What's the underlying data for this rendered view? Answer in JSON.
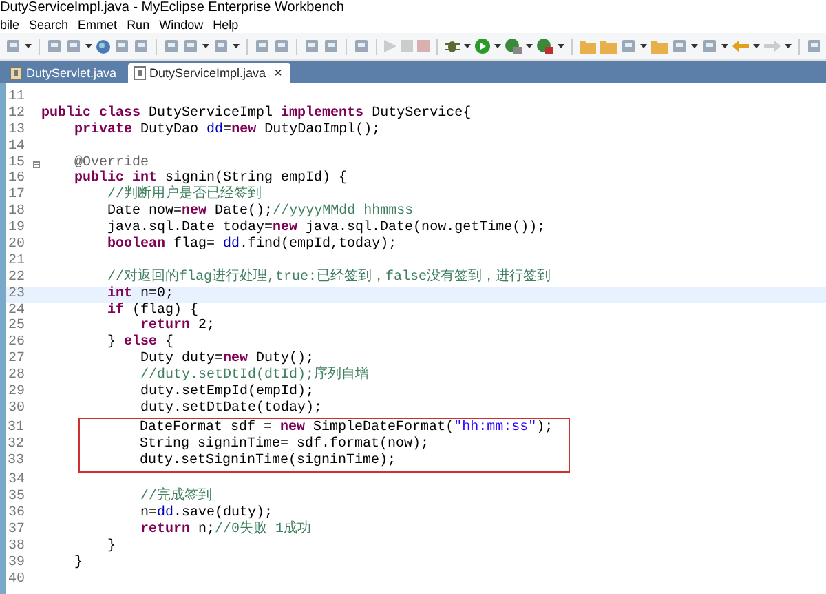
{
  "window": {
    "title": "DutyServiceImpl.java - MyEclipse Enterprise Workbench"
  },
  "menu": [
    "bile",
    "Search",
    "Emmet",
    "Run",
    "Window",
    "Help"
  ],
  "tabs": [
    {
      "label": "DutyServlet.java",
      "selected": false,
      "closable": false
    },
    {
      "label": "DutyServiceImpl.java",
      "selected": true,
      "closable": true
    }
  ],
  "close_glyph": "×",
  "editor": {
    "lines": [
      {
        "number": "11",
        "fold": false,
        "current": false,
        "in_box": false
      },
      {
        "number": "12",
        "fold": false,
        "current": false,
        "in_box": false,
        "segments": [
          {
            "kind": "keyword",
            "text": "public class"
          },
          {
            "kind": "plain",
            "text": " DutyServiceImpl "
          },
          {
            "kind": "keyword",
            "text": "implements"
          },
          {
            "kind": "plain",
            "text": " DutyService{"
          }
        ]
      },
      {
        "number": "13",
        "fold": false,
        "current": false,
        "in_box": false,
        "segments": [
          {
            "kind": "keyword",
            "text": "    private"
          },
          {
            "kind": "plain",
            "text": " DutyDao "
          },
          {
            "kind": "field",
            "text": "dd"
          },
          {
            "kind": "plain",
            "text": "="
          },
          {
            "kind": "keyword",
            "text": "new"
          },
          {
            "kind": "plain",
            "text": " DutyDaoImpl();"
          }
        ]
      },
      {
        "number": "14",
        "fold": false,
        "current": false,
        "in_box": false
      },
      {
        "number": "15",
        "fold": true,
        "current": false,
        "in_box": false,
        "segments": [
          {
            "kind": "annotation",
            "text": "    @Override"
          }
        ]
      },
      {
        "number": "16",
        "fold": false,
        "current": false,
        "in_box": false,
        "segments": [
          {
            "kind": "keyword",
            "text": "    public int"
          },
          {
            "kind": "plain",
            "text": " signin(String empId) {"
          }
        ]
      },
      {
        "number": "17",
        "fold": false,
        "current": false,
        "in_box": false,
        "segments": [
          {
            "kind": "comment",
            "text": "        //判断用户是否已经签到"
          }
        ]
      },
      {
        "number": "18",
        "fold": false,
        "current": false,
        "in_box": false,
        "segments": [
          {
            "kind": "plain",
            "text": "        Date now="
          },
          {
            "kind": "keyword",
            "text": "new"
          },
          {
            "kind": "plain",
            "text": " Date();"
          },
          {
            "kind": "comment",
            "text": "//yyyyMMdd hhmmss"
          }
        ]
      },
      {
        "number": "19",
        "fold": false,
        "current": false,
        "in_box": false,
        "segments": [
          {
            "kind": "plain",
            "text": "        java.sql.Date today="
          },
          {
            "kind": "keyword",
            "text": "new"
          },
          {
            "kind": "plain",
            "text": " java.sql.Date(now.getTime());"
          }
        ]
      },
      {
        "number": "20",
        "fold": false,
        "current": false,
        "in_box": false,
        "segments": [
          {
            "kind": "keyword",
            "text": "        boolean"
          },
          {
            "kind": "plain",
            "text": " flag= "
          },
          {
            "kind": "field",
            "text": "dd"
          },
          {
            "kind": "plain",
            "text": ".find(empId,today);"
          }
        ]
      },
      {
        "number": "21",
        "fold": false,
        "current": false,
        "in_box": false
      },
      {
        "number": "22",
        "fold": false,
        "current": false,
        "in_box": false,
        "segments": [
          {
            "kind": "comment",
            "text": "        //对返回的flag进行处理,true:已经签到，false没有签到，进行签到"
          }
        ]
      },
      {
        "number": "23",
        "fold": false,
        "current": true,
        "in_box": false,
        "segments": [
          {
            "kind": "keyword",
            "text": "        int"
          },
          {
            "kind": "plain",
            "text": " n=0;"
          }
        ]
      },
      {
        "number": "24",
        "fold": false,
        "current": false,
        "in_box": false,
        "segments": [
          {
            "kind": "keyword",
            "text": "        if"
          },
          {
            "kind": "plain",
            "text": " (flag) {"
          }
        ]
      },
      {
        "number": "25",
        "fold": false,
        "current": false,
        "in_box": false,
        "segments": [
          {
            "kind": "keyword",
            "text": "            return"
          },
          {
            "kind": "plain",
            "text": " 2;"
          }
        ]
      },
      {
        "number": "26",
        "fold": false,
        "current": false,
        "in_box": false,
        "segments": [
          {
            "kind": "plain",
            "text": "        } "
          },
          {
            "kind": "keyword",
            "text": "else"
          },
          {
            "kind": "plain",
            "text": " {"
          }
        ]
      },
      {
        "number": "27",
        "fold": false,
        "current": false,
        "in_box": false,
        "segments": [
          {
            "kind": "plain",
            "text": "            Duty duty="
          },
          {
            "kind": "keyword",
            "text": "new"
          },
          {
            "kind": "plain",
            "text": " Duty();"
          }
        ]
      },
      {
        "number": "28",
        "fold": false,
        "current": false,
        "in_box": false,
        "segments": [
          {
            "kind": "comment",
            "text": "            //duty.setDtId(dtId);序列自增"
          }
        ]
      },
      {
        "number": "29",
        "fold": false,
        "current": false,
        "in_box": false,
        "segments": [
          {
            "kind": "plain",
            "text": "            duty.setEmpId(empId);"
          }
        ]
      },
      {
        "number": "30",
        "fold": false,
        "current": false,
        "in_box": false,
        "segments": [
          {
            "kind": "plain",
            "text": "            duty.setDtDate(today);"
          }
        ]
      },
      {
        "number": "31",
        "fold": false,
        "current": false,
        "in_box": true,
        "segments": [
          {
            "kind": "plain",
            "text": "            DateFormat sdf = "
          },
          {
            "kind": "keyword",
            "text": "new"
          },
          {
            "kind": "plain",
            "text": " SimpleDateFormat("
          },
          {
            "kind": "string",
            "text": "\"hh:mm:ss\""
          },
          {
            "kind": "plain",
            "text": ");"
          }
        ]
      },
      {
        "number": "32",
        "fold": false,
        "current": false,
        "in_box": true,
        "segments": [
          {
            "kind": "plain",
            "text": "            String signinTime= sdf.format(now);"
          }
        ]
      },
      {
        "number": "33",
        "fold": false,
        "current": false,
        "in_box": true,
        "segments": [
          {
            "kind": "plain",
            "text": "            duty.setSigninTime(signinTime);"
          }
        ]
      },
      {
        "number": "34",
        "fold": false,
        "current": false,
        "in_box": false
      },
      {
        "number": "35",
        "fold": false,
        "current": false,
        "in_box": false,
        "segments": [
          {
            "kind": "comment",
            "text": "            //完成签到"
          }
        ]
      },
      {
        "number": "36",
        "fold": false,
        "current": false,
        "in_box": false,
        "segments": [
          {
            "kind": "plain",
            "text": "            n="
          },
          {
            "kind": "field",
            "text": "dd"
          },
          {
            "kind": "plain",
            "text": ".save(duty);"
          }
        ]
      },
      {
        "number": "37",
        "fold": false,
        "current": false,
        "in_box": false,
        "segments": [
          {
            "kind": "keyword",
            "text": "            return"
          },
          {
            "kind": "plain",
            "text": " n;"
          },
          {
            "kind": "comment",
            "text": "//0失败 1成功"
          }
        ]
      },
      {
        "number": "38",
        "fold": false,
        "current": false,
        "in_box": false,
        "segments": [
          {
            "kind": "plain",
            "text": "        }"
          }
        ]
      },
      {
        "number": "39",
        "fold": false,
        "current": false,
        "in_box": false,
        "segments": [
          {
            "kind": "plain",
            "text": "    }"
          }
        ]
      },
      {
        "number": "40",
        "fold": false,
        "current": false,
        "in_box": false
      }
    ]
  }
}
